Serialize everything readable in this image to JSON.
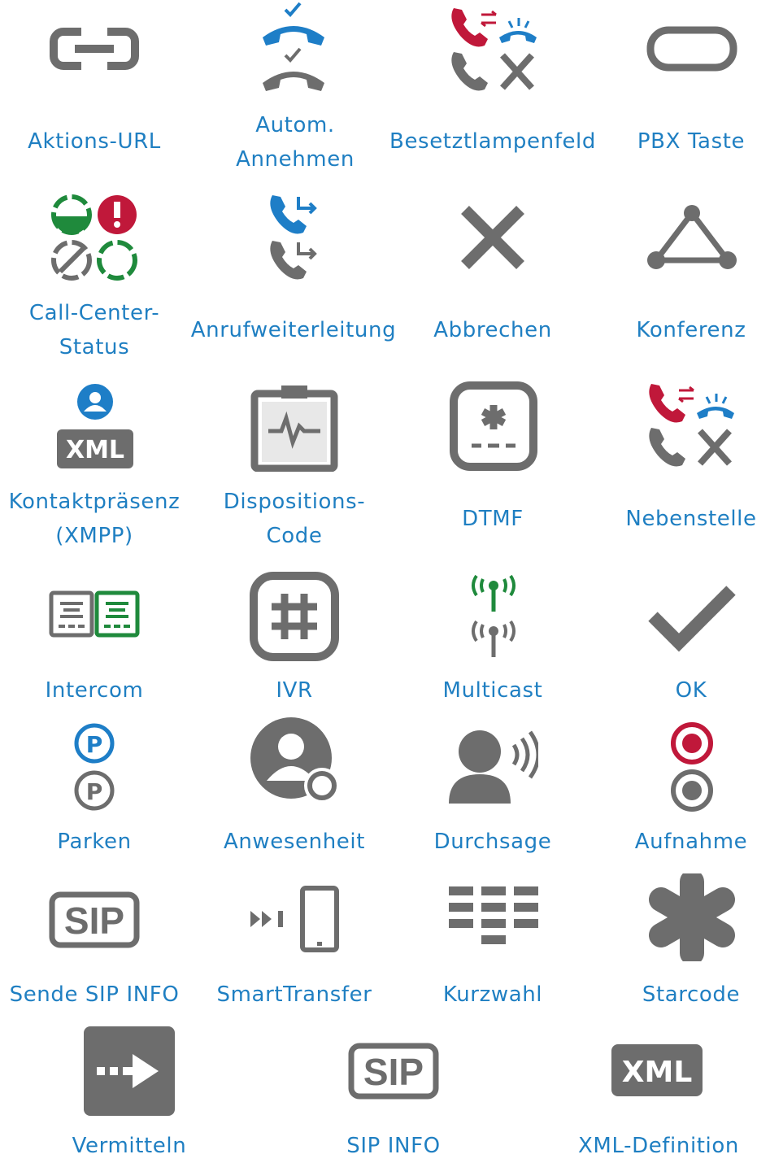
{
  "colors": {
    "label": "#1f7fc2",
    "icon_gray": "#6d6d6d",
    "icon_blue": "#1e7ec7",
    "icon_red": "#c0183a",
    "icon_green": "#1f8a3c"
  },
  "items": [
    {
      "label": "Aktions-URL",
      "icon": "link-icon"
    },
    {
      "label": "Autom. Annehmen",
      "icon": "auto-answer-icon"
    },
    {
      "label": "Besetztlampenfeld",
      "icon": "busy-lamp-field-icon"
    },
    {
      "label": "PBX Taste",
      "icon": "pbx-key-icon"
    },
    {
      "label": "Call-Center-Status",
      "icon": "call-center-status-icon"
    },
    {
      "label": "Anrufweiterleitung",
      "icon": "call-forward-icon"
    },
    {
      "label": "Abbrechen",
      "icon": "cancel-icon"
    },
    {
      "label": "Konferenz",
      "icon": "conference-icon"
    },
    {
      "label": "Kontaktpräsenz (XMPP)",
      "icon": "contact-presence-xml-icon"
    },
    {
      "label": "Dispositions-Code",
      "icon": "disposition-code-icon"
    },
    {
      "label": "DTMF",
      "icon": "dtmf-icon"
    },
    {
      "label": "Nebenstelle",
      "icon": "extension-icon"
    },
    {
      "label": "Intercom",
      "icon": "intercom-icon"
    },
    {
      "label": "IVR",
      "icon": "ivr-hash-icon"
    },
    {
      "label": "Multicast",
      "icon": "multicast-icon"
    },
    {
      "label": "OK",
      "icon": "checkmark-icon"
    },
    {
      "label": "Parken",
      "icon": "park-icon"
    },
    {
      "label": "Anwesenheit",
      "icon": "presence-icon"
    },
    {
      "label": "Durchsage",
      "icon": "paging-icon"
    },
    {
      "label": "Aufnahme",
      "icon": "record-icon"
    },
    {
      "label": "Sende SIP INFO",
      "icon": "send-sip-info-icon"
    },
    {
      "label": "SmartTransfer",
      "icon": "smart-transfer-icon"
    },
    {
      "label": "Kurzwahl",
      "icon": "speed-dial-icon"
    },
    {
      "label": "Starcode",
      "icon": "starcode-icon"
    },
    {
      "label": "Vermitteln",
      "icon": "transfer-icon"
    },
    {
      "label": "SIP INFO",
      "icon": "sip-info-icon"
    },
    {
      "label": "XML-Definition",
      "icon": "xml-definition-icon"
    }
  ]
}
